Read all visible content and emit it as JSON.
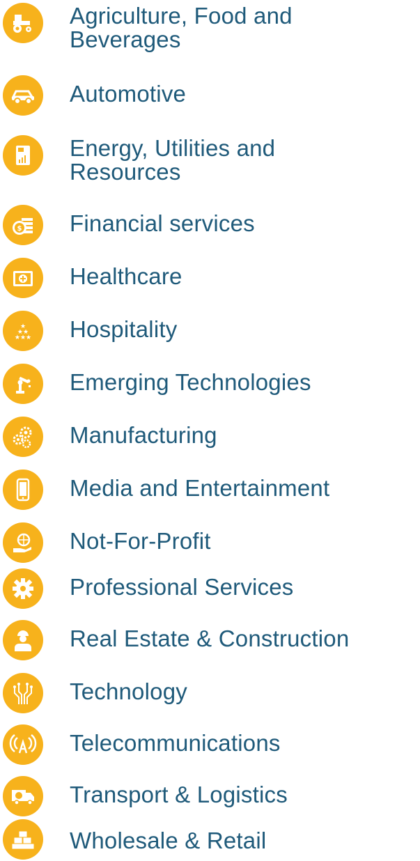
{
  "brand": {
    "accent_color": "#f7b21c",
    "text_color": "#1f5a7a"
  },
  "industries": [
    {
      "label": "Agriculture, Food and Beverages",
      "icon": "tractor-icon"
    },
    {
      "label": "Automotive",
      "icon": "car-icon"
    },
    {
      "label": "Energy, Utilities and Resources",
      "icon": "energy-meter-icon"
    },
    {
      "label": "Financial services",
      "icon": "coins-icon"
    },
    {
      "label": "Healthcare",
      "icon": "medical-kit-icon"
    },
    {
      "label": "Hospitality",
      "icon": "stars-icon"
    },
    {
      "label": "Emerging Technologies",
      "icon": "robot-arm-icon"
    },
    {
      "label": "Manufacturing",
      "icon": "gears-icon"
    },
    {
      "label": "Media and Entertainment",
      "icon": "mobile-phone-icon"
    },
    {
      "label": "Not-For-Profit",
      "icon": "globe-in-hand-icon"
    },
    {
      "label": "Professional Services",
      "icon": "cog-icon"
    },
    {
      "label": "Real Estate & Construction",
      "icon": "construction-worker-icon"
    },
    {
      "label": "Technology",
      "icon": "circuit-icon"
    },
    {
      "label": "Telecommunications",
      "icon": "antenna-icon"
    },
    {
      "label": "Transport & Logistics",
      "icon": "delivery-truck-icon"
    },
    {
      "label": "Wholesale & Retail",
      "icon": "stacked-boxes-icon"
    }
  ]
}
